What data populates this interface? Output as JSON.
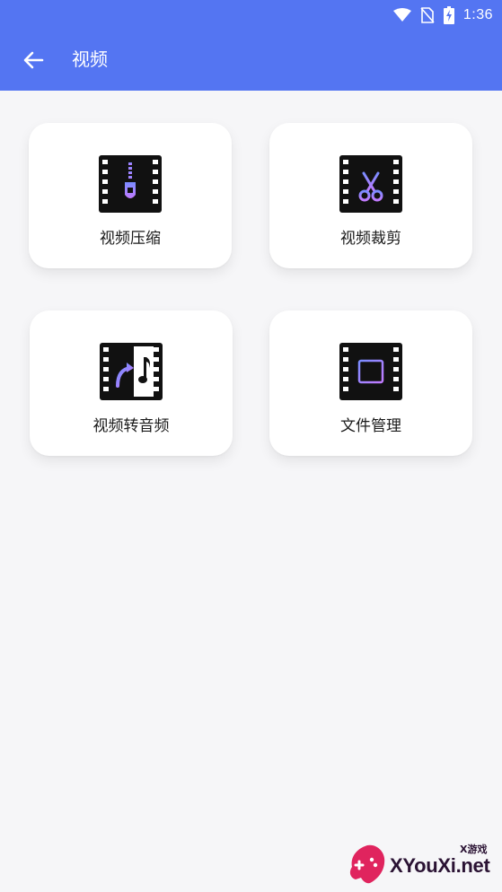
{
  "status_bar": {
    "time": "1:36"
  },
  "header": {
    "title": "视频",
    "color": "#5475f2"
  },
  "cards": [
    {
      "label": "视频压缩",
      "icon": "video-compress-icon"
    },
    {
      "label": "视频裁剪",
      "icon": "video-cut-icon"
    },
    {
      "label": "视频转音频",
      "icon": "video-to-audio-icon"
    },
    {
      "label": "文件管理",
      "icon": "file-manager-icon"
    }
  ],
  "watermark": {
    "text": "XYouXi.net",
    "sub": "X游戏"
  }
}
